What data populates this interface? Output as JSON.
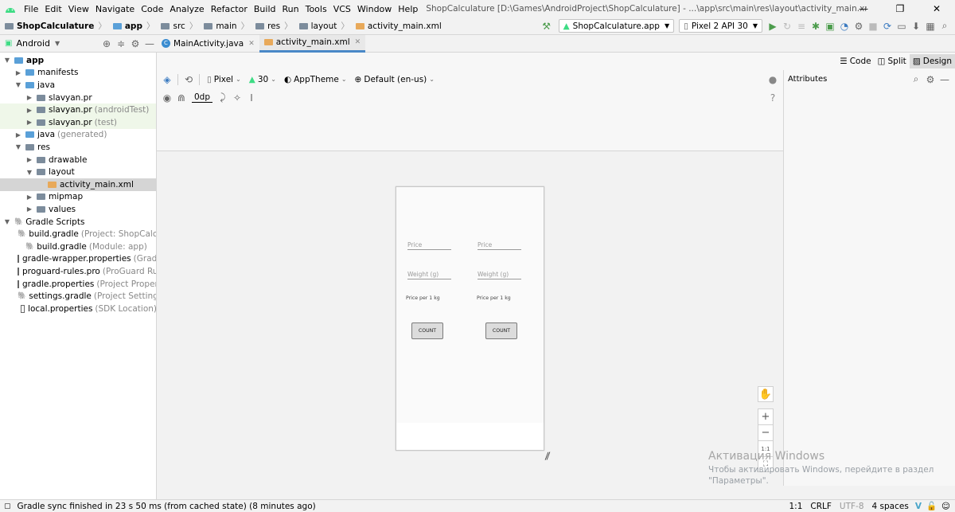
{
  "menubar": {
    "items": [
      "File",
      "Edit",
      "View",
      "Navigate",
      "Code",
      "Analyze",
      "Refactor",
      "Build",
      "Run",
      "Tools",
      "VCS",
      "Window",
      "Help"
    ],
    "title": "ShopCalculature [D:\\Games\\AndroidProject\\ShopCalculature] - ...\\app\\src\\main\\res\\layout\\activity_main.xml [app] - Android Studio"
  },
  "breadcrumb": [
    "ShopCalculature",
    "app",
    "src",
    "main",
    "res",
    "layout",
    "activity_main.xml"
  ],
  "toolbar": {
    "run_config": "ShopCalculature.app",
    "device": "Pixel 2 API 30"
  },
  "project_panel": {
    "view_label": "Android"
  },
  "editor_tabs": [
    "MainActivity.java",
    "activity_main.xml"
  ],
  "tree": [
    {
      "label": "app",
      "extra": "",
      "indent": 0,
      "arrow": "▾",
      "icon": "blue",
      "bold": true
    },
    {
      "label": "manifests",
      "extra": "",
      "indent": 1,
      "arrow": "▸",
      "icon": "blue"
    },
    {
      "label": "java",
      "extra": "",
      "indent": 1,
      "arrow": "▾",
      "icon": "blue"
    },
    {
      "label": "slavyan.pr",
      "extra": "",
      "indent": 2,
      "arrow": "▸",
      "icon": "gray"
    },
    {
      "label": "slavyan.pr",
      "extra": "(androidTest)",
      "indent": 2,
      "arrow": "▸",
      "icon": "gray",
      "green": true
    },
    {
      "label": "slavyan.pr",
      "extra": "(test)",
      "indent": 2,
      "arrow": "▸",
      "icon": "gray",
      "green": true
    },
    {
      "label": "java",
      "extra": "(generated)",
      "indent": 1,
      "arrow": "▸",
      "icon": "blue"
    },
    {
      "label": "res",
      "extra": "",
      "indent": 1,
      "arrow": "▾",
      "icon": "gray"
    },
    {
      "label": "drawable",
      "extra": "",
      "indent": 2,
      "arrow": "▸",
      "icon": "gray"
    },
    {
      "label": "layout",
      "extra": "",
      "indent": 2,
      "arrow": "▾",
      "icon": "gray"
    },
    {
      "label": "activity_main.xml",
      "extra": "",
      "indent": 3,
      "arrow": "",
      "icon": "orange",
      "selected": true
    },
    {
      "label": "mipmap",
      "extra": "",
      "indent": 2,
      "arrow": "▸",
      "icon": "gray"
    },
    {
      "label": "values",
      "extra": "",
      "indent": 2,
      "arrow": "▸",
      "icon": "gray"
    },
    {
      "label": "Gradle Scripts",
      "extra": "",
      "indent": 0,
      "arrow": "▾",
      "icon": "gradle"
    },
    {
      "label": "build.gradle",
      "extra": "(Project: ShopCalculature)",
      "indent": 1,
      "arrow": "",
      "icon": "gradle"
    },
    {
      "label": "build.gradle",
      "extra": "(Module: app)",
      "indent": 1,
      "arrow": "",
      "icon": "gradle"
    },
    {
      "label": "gradle-wrapper.properties",
      "extra": "(Gradle Version)",
      "indent": 1,
      "arrow": "",
      "icon": "file"
    },
    {
      "label": "proguard-rules.pro",
      "extra": "(ProGuard Rules for app)",
      "indent": 1,
      "arrow": "",
      "icon": "file"
    },
    {
      "label": "gradle.properties",
      "extra": "(Project Properties)",
      "indent": 1,
      "arrow": "",
      "icon": "file"
    },
    {
      "label": "settings.gradle",
      "extra": "(Project Settings)",
      "indent": 1,
      "arrow": "",
      "icon": "gradle"
    },
    {
      "label": "local.properties",
      "extra": "(SDK Location)",
      "indent": 1,
      "arrow": "",
      "icon": "file"
    }
  ],
  "view_modes": [
    "Code",
    "Split",
    "Design"
  ],
  "design_toolbar": {
    "device": "Pixel",
    "api": "30",
    "theme": "AppTheme",
    "locale": "Default (en-us)",
    "margin": "0dp"
  },
  "attributes": {
    "title": "Attributes"
  },
  "phone": {
    "price_hint": "Price",
    "weight_hint": "Weight (g)",
    "per_kg_label": "Price per 1 kg",
    "count_button": "COUNT"
  },
  "zoom": {
    "fit_label": "1:1"
  },
  "watermark": {
    "line1": "Активация Windows",
    "line2": "Чтобы активировать Windows, перейдите в раздел",
    "line3": "\"Параметры\"."
  },
  "statusbar": {
    "message": "Gradle sync finished in 23 s 50 ms (from cached state) (8 minutes ago)",
    "position": "1:1",
    "line_sep": "CRLF",
    "encoding": "UTF-8",
    "indent": "4 spaces"
  }
}
